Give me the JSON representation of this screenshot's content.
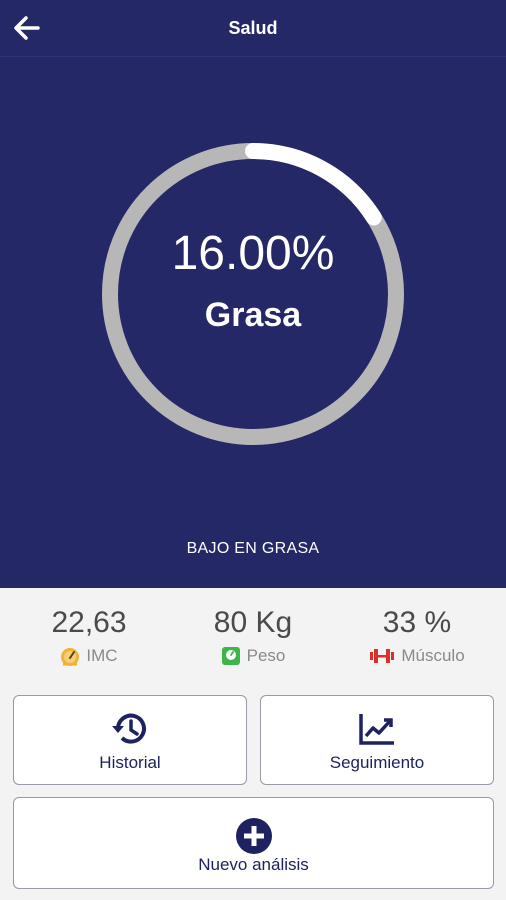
{
  "header": {
    "title": "Salud"
  },
  "gauge": {
    "value_text": "16.00%",
    "label": "Grasa",
    "fraction": 0.16,
    "track_color": "#b7b7b7",
    "fill_color": "#ffffff"
  },
  "status": {
    "text": "BAJO EN GRASA"
  },
  "stats": [
    {
      "value": "22,63",
      "label": "IMC",
      "icon": "gauge-icon",
      "color": "#f2b233"
    },
    {
      "value": "80 Kg",
      "label": "Peso",
      "icon": "scale-icon",
      "color": "#3db54a"
    },
    {
      "value": "33 %",
      "label": "Músculo",
      "icon": "dumbbell-icon",
      "color": "#d9302c"
    }
  ],
  "actions": {
    "historial": "Historial",
    "seguimiento": "Seguimiento",
    "nuevo": "Nuevo análisis"
  },
  "colors": {
    "brand": "#242866",
    "accent": "#1e2261"
  }
}
